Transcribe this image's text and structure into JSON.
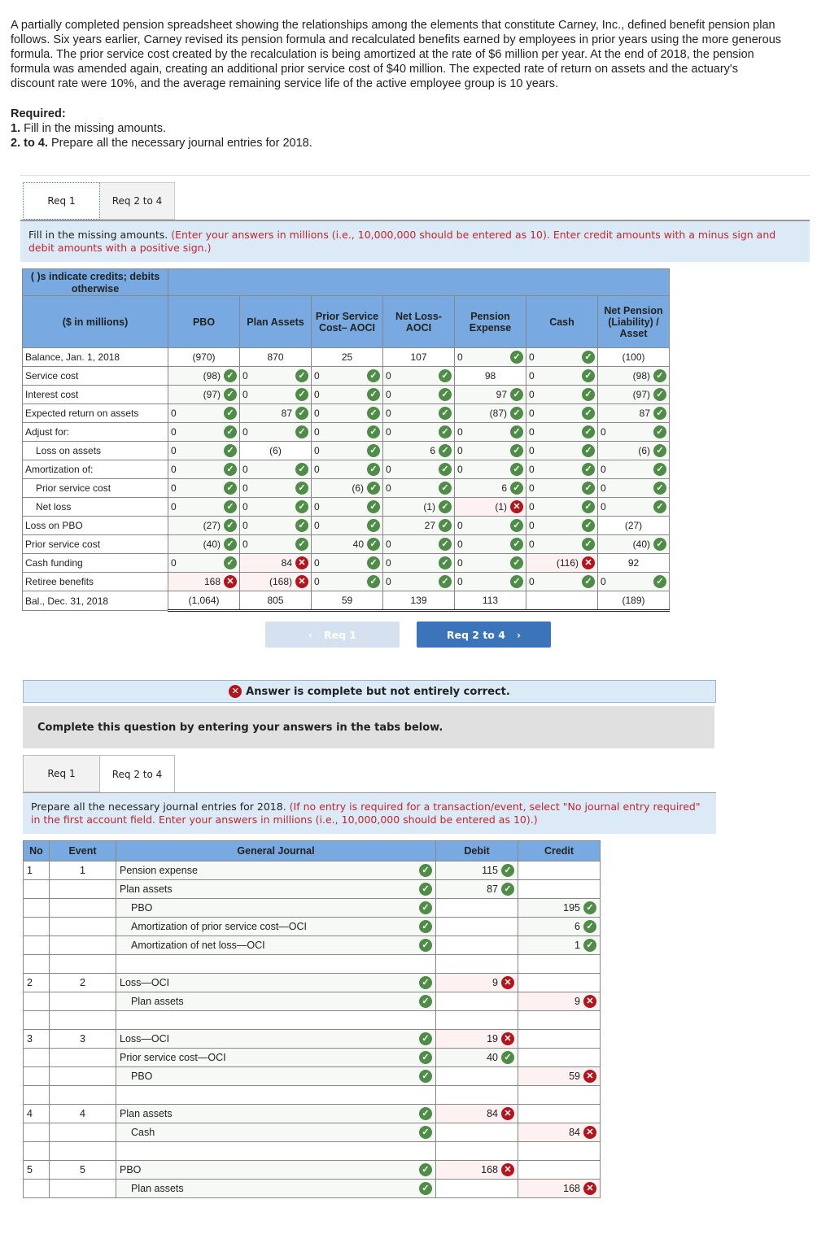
{
  "intro": {
    "paragraph": "A partially completed pension spreadsheet showing the relationships among the elements that constitute Carney, Inc., defined benefit pension plan follows. Six years earlier, Carney revised its pension formula and recalculated benefits earned by employees in prior years using the more generous formula. The prior service cost created by the recalculation is being amortized at the rate of $6 million per year. At the end of 2018, the pension formula was amended again, creating an additional prior service cost of $40 million. The expected rate of return on assets and the actuary's discount rate were 10%, and the average remaining service life of the active employee group is 10 years.",
    "required_label": "Required:",
    "req1_num": "1.",
    "req1_text": " Fill in the missing amounts.",
    "req2_num": "2. to 4.",
    "req2_text": " Prepare all the necessary journal entries for 2018."
  },
  "tabs_top": {
    "req1": "Req 1",
    "req2": "Req 2 to 4"
  },
  "instructions_req1": {
    "lead": "Fill in the missing amounts. ",
    "note": "(Enter your answers in millions (i.e., 10,000,000 should be entered as 10). Enter credit amounts with a minus sign and debit amounts with a positive sign.)"
  },
  "worksheet": {
    "corner_note": "( )s indicate credits; debits otherwise",
    "unit_label": "($ in millions)",
    "columns": [
      "PBO",
      "Plan Assets",
      "Prior Service Cost– AOCI",
      "Net Loss- AOCI",
      "Pension Expense",
      "Cash",
      "Net Pension (Liability) / Asset"
    ],
    "rows": [
      {
        "label": "Balance, Jan. 1, 2018",
        "indent": false,
        "cells": [
          {
            "v": "(970)",
            "s": "given"
          },
          {
            "v": "870",
            "s": "given"
          },
          {
            "v": "25",
            "s": "given"
          },
          {
            "v": "107",
            "s": "given"
          },
          {
            "v": "0",
            "s": "ok"
          },
          {
            "v": "0",
            "s": "ok"
          },
          {
            "v": "(100)",
            "s": "given"
          }
        ]
      },
      {
        "label": "Service cost",
        "indent": false,
        "cells": [
          {
            "v": "(98)",
            "s": "ok"
          },
          {
            "v": "0",
            "s": "ok"
          },
          {
            "v": "0",
            "s": "ok"
          },
          {
            "v": "0",
            "s": "ok"
          },
          {
            "v": "98",
            "s": "given"
          },
          {
            "v": "0",
            "s": "ok"
          },
          {
            "v": "(98)",
            "s": "ok"
          }
        ]
      },
      {
        "label": "Interest cost",
        "indent": false,
        "cells": [
          {
            "v": "(97)",
            "s": "ok"
          },
          {
            "v": "0",
            "s": "ok"
          },
          {
            "v": "0",
            "s": "ok"
          },
          {
            "v": "0",
            "s": "ok"
          },
          {
            "v": "97",
            "s": "ok"
          },
          {
            "v": "0",
            "s": "ok"
          },
          {
            "v": "(97)",
            "s": "ok"
          }
        ]
      },
      {
        "label": "Expected return on assets",
        "indent": false,
        "cells": [
          {
            "v": "0",
            "s": "ok"
          },
          {
            "v": "87",
            "s": "ok"
          },
          {
            "v": "0",
            "s": "ok"
          },
          {
            "v": "0",
            "s": "ok"
          },
          {
            "v": "(87)",
            "s": "ok"
          },
          {
            "v": "0",
            "s": "ok"
          },
          {
            "v": "87",
            "s": "ok"
          }
        ]
      },
      {
        "label": "Adjust for:",
        "indent": false,
        "cells": [
          {
            "v": "0",
            "s": "ok"
          },
          {
            "v": "0",
            "s": "ok"
          },
          {
            "v": "0",
            "s": "ok"
          },
          {
            "v": "0",
            "s": "ok"
          },
          {
            "v": "0",
            "s": "ok"
          },
          {
            "v": "0",
            "s": "ok"
          },
          {
            "v": "0",
            "s": "ok"
          }
        ]
      },
      {
        "label": "Loss on assets",
        "indent": true,
        "cells": [
          {
            "v": "0",
            "s": "ok"
          },
          {
            "v": "(6)",
            "s": "given"
          },
          {
            "v": "0",
            "s": "ok"
          },
          {
            "v": "6",
            "s": "ok"
          },
          {
            "v": "0",
            "s": "ok"
          },
          {
            "v": "0",
            "s": "ok"
          },
          {
            "v": "(6)",
            "s": "ok"
          }
        ]
      },
      {
        "label": "Amortization of:",
        "indent": false,
        "cells": [
          {
            "v": "0",
            "s": "ok"
          },
          {
            "v": "0",
            "s": "ok"
          },
          {
            "v": "0",
            "s": "ok"
          },
          {
            "v": "0",
            "s": "ok"
          },
          {
            "v": "0",
            "s": "ok"
          },
          {
            "v": "0",
            "s": "ok"
          },
          {
            "v": "0",
            "s": "ok"
          }
        ]
      },
      {
        "label": "Prior service cost",
        "indent": true,
        "cells": [
          {
            "v": "0",
            "s": "ok"
          },
          {
            "v": "0",
            "s": "ok"
          },
          {
            "v": "(6)",
            "s": "ok"
          },
          {
            "v": "0",
            "s": "ok"
          },
          {
            "v": "6",
            "s": "ok"
          },
          {
            "v": "0",
            "s": "ok"
          },
          {
            "v": "0",
            "s": "ok"
          }
        ]
      },
      {
        "label": "Net loss",
        "indent": true,
        "cells": [
          {
            "v": "0",
            "s": "ok"
          },
          {
            "v": "0",
            "s": "ok"
          },
          {
            "v": "0",
            "s": "ok"
          },
          {
            "v": "(1)",
            "s": "ok"
          },
          {
            "v": "(1)",
            "s": "bad"
          },
          {
            "v": "0",
            "s": "ok"
          },
          {
            "v": "0",
            "s": "ok"
          }
        ]
      },
      {
        "label": "Loss on PBO",
        "indent": false,
        "cells": [
          {
            "v": "(27)",
            "s": "ok"
          },
          {
            "v": "0",
            "s": "ok"
          },
          {
            "v": "0",
            "s": "ok"
          },
          {
            "v": "27",
            "s": "ok"
          },
          {
            "v": "0",
            "s": "ok"
          },
          {
            "v": "0",
            "s": "ok"
          },
          {
            "v": "(27)",
            "s": "given"
          }
        ]
      },
      {
        "label": "Prior service cost",
        "indent": false,
        "cells": [
          {
            "v": "(40)",
            "s": "ok"
          },
          {
            "v": "0",
            "s": "ok"
          },
          {
            "v": "40",
            "s": "ok"
          },
          {
            "v": "0",
            "s": "ok"
          },
          {
            "v": "0",
            "s": "ok"
          },
          {
            "v": "0",
            "s": "ok"
          },
          {
            "v": "(40)",
            "s": "ok"
          }
        ]
      },
      {
        "label": "Cash funding",
        "indent": false,
        "cells": [
          {
            "v": "0",
            "s": "ok"
          },
          {
            "v": "84",
            "s": "bad"
          },
          {
            "v": "0",
            "s": "ok"
          },
          {
            "v": "0",
            "s": "ok"
          },
          {
            "v": "0",
            "s": "ok"
          },
          {
            "v": "(116)",
            "s": "bad"
          },
          {
            "v": "92",
            "s": "given"
          }
        ]
      },
      {
        "label": "Retiree benefits",
        "indent": false,
        "cells": [
          {
            "v": "168",
            "s": "bad"
          },
          {
            "v": "(168)",
            "s": "bad"
          },
          {
            "v": "0",
            "s": "ok"
          },
          {
            "v": "0",
            "s": "ok"
          },
          {
            "v": "0",
            "s": "ok"
          },
          {
            "v": "0",
            "s": "ok"
          },
          {
            "v": "0",
            "s": "ok"
          }
        ]
      },
      {
        "label": "Bal., Dec. 31, 2018",
        "indent": false,
        "total": true,
        "cells": [
          {
            "v": "(1,064)",
            "s": "given"
          },
          {
            "v": "805",
            "s": "given"
          },
          {
            "v": "59",
            "s": "given"
          },
          {
            "v": "139",
            "s": "given"
          },
          {
            "v": "113",
            "s": "given"
          },
          {
            "v": "",
            "s": "given"
          },
          {
            "v": "(189)",
            "s": "given"
          }
        ]
      }
    ]
  },
  "nav": {
    "prev_label": "Req 1",
    "next_label": "Req 2 to 4"
  },
  "result_banner": "Answer is complete but not entirely correct.",
  "complete_prompt": "Complete this question by entering your answers in the tabs below.",
  "tabs_bottom": {
    "req1": "Req 1",
    "req2": "Req 2 to 4"
  },
  "instructions_req2": {
    "lead": "Prepare all the necessary journal entries for 2018. ",
    "note": "(If no entry is required for a transaction/event, select \"No journal entry required\" in the first account field. Enter your answers in millions (i.e., 10,000,000 should be entered as 10).)"
  },
  "journal": {
    "headers": {
      "no": "No",
      "event": "Event",
      "general_journal": "General Journal",
      "debit": "Debit",
      "credit": "Credit"
    },
    "rows": [
      {
        "no": "1",
        "event": "1",
        "account": "Pension expense",
        "credit_side": false,
        "debit": "115",
        "debit_s": "ok",
        "credit": "",
        "credit_s": ""
      },
      {
        "no": "",
        "event": "",
        "account": "Plan assets",
        "credit_side": false,
        "debit": "87",
        "debit_s": "ok",
        "credit": "",
        "credit_s": ""
      },
      {
        "no": "",
        "event": "",
        "account": "PBO",
        "credit_side": true,
        "debit": "",
        "debit_s": "",
        "credit": "195",
        "credit_s": "ok"
      },
      {
        "no": "",
        "event": "",
        "account": "Amortization of prior service cost—OCI",
        "credit_side": true,
        "debit": "",
        "debit_s": "",
        "credit": "6",
        "credit_s": "ok"
      },
      {
        "no": "",
        "event": "",
        "account": "Amortization of net loss—OCI",
        "credit_side": true,
        "debit": "",
        "debit_s": "",
        "credit": "1",
        "credit_s": "ok"
      },
      {
        "blank": true
      },
      {
        "no": "2",
        "event": "2",
        "account": "Loss—OCI",
        "credit_side": false,
        "debit": "9",
        "debit_s": "bad",
        "credit": "",
        "credit_s": ""
      },
      {
        "no": "",
        "event": "",
        "account": "Plan assets",
        "credit_side": true,
        "debit": "",
        "debit_s": "",
        "credit": "9",
        "credit_s": "bad"
      },
      {
        "blank": true
      },
      {
        "no": "3",
        "event": "3",
        "account": "Loss—OCI",
        "credit_side": false,
        "debit": "19",
        "debit_s": "bad",
        "credit": "",
        "credit_s": ""
      },
      {
        "no": "",
        "event": "",
        "account": "Prior service cost—OCI",
        "credit_side": false,
        "debit": "40",
        "debit_s": "ok",
        "credit": "",
        "credit_s": ""
      },
      {
        "no": "",
        "event": "",
        "account": "PBO",
        "credit_side": true,
        "debit": "",
        "debit_s": "",
        "credit": "59",
        "credit_s": "bad"
      },
      {
        "blank": true
      },
      {
        "no": "4",
        "event": "4",
        "account": "Plan assets",
        "credit_side": false,
        "debit": "84",
        "debit_s": "bad",
        "credit": "",
        "credit_s": ""
      },
      {
        "no": "",
        "event": "",
        "account": "Cash",
        "credit_side": true,
        "debit": "",
        "debit_s": "",
        "credit": "84",
        "credit_s": "bad"
      },
      {
        "blank": true
      },
      {
        "no": "5",
        "event": "5",
        "account": "PBO",
        "credit_side": false,
        "debit": "168",
        "debit_s": "bad",
        "credit": "",
        "credit_s": ""
      },
      {
        "no": "",
        "event": "",
        "account": "Plan assets",
        "credit_side": true,
        "debit": "",
        "debit_s": "",
        "credit": "168",
        "credit_s": "bad"
      }
    ]
  },
  "icons": {
    "correct": "check-circle-icon",
    "incorrect": "x-circle-icon"
  },
  "colors": {
    "header_blue": "#78a9e0",
    "correct_green": "#4e8c48",
    "incorrect_red": "#b0161d",
    "instruction_red": "#c0262d",
    "next_button": "#3b74b9"
  }
}
